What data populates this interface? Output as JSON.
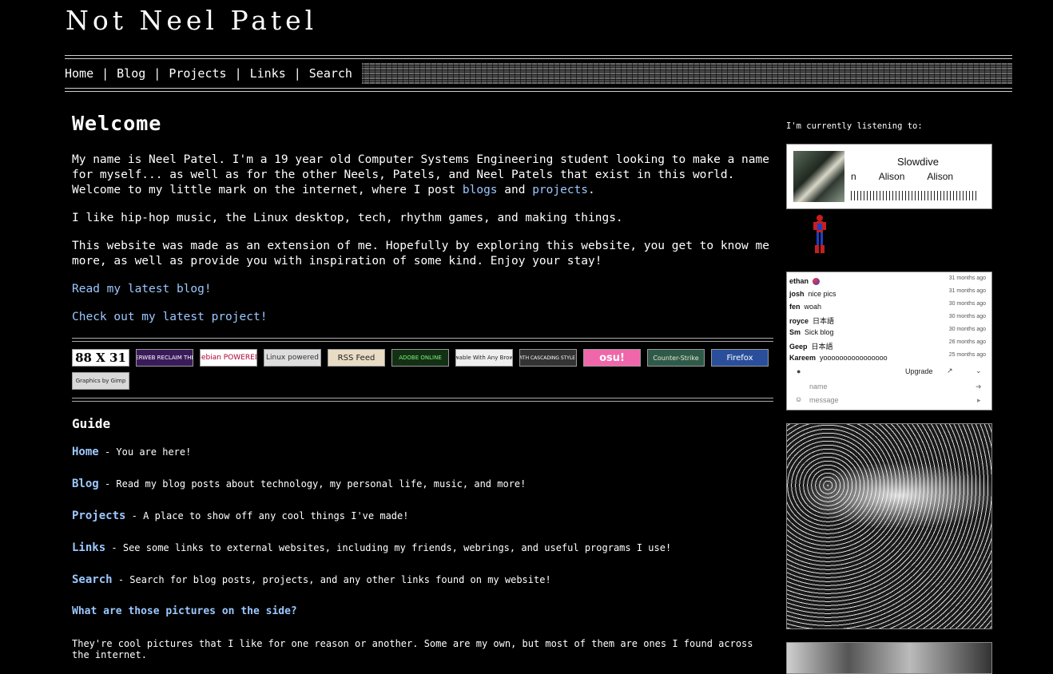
{
  "site": {
    "title": "Not Neel Patel"
  },
  "nav": {
    "items": [
      "Home",
      "Blog",
      "Projects",
      "Links",
      "Search"
    ],
    "separator": "|"
  },
  "welcome": {
    "heading": "Welcome",
    "p1_text": "My name is Neel Patel. I'm a 19 year old Computer Systems Engineering student looking to make a name for myself... as well as for the other Neels, Patels, and Neel Patels that exist in this world. Welcome to my little mark on the internet, where I post ",
    "p1_link1": "blogs",
    "p1_and": " and ",
    "p1_link2": "projects",
    "p1_end": ".",
    "p2": "I like hip-hop music, the Linux desktop, tech, rhythm games, and making things.",
    "p3": "This website was made as an extension of me. Hopefully by exploring this website, you get to know me more, as well as provide you with inspiration of some kind. Enjoy your stay!",
    "latest_blog": "Read my latest blog!",
    "latest_project": "Check out my latest project!"
  },
  "buttons": [
    "88 X 31",
    "YESTERWEB RECLAIM THE NET",
    "debian POWERED",
    "Linux powered",
    "RSS Feed",
    "ADOBE ONLINE",
    "Viewable With Any Browser",
    "MADE WITH CASCADING STYLE SHEETS",
    "osu!",
    "Counter-Strike",
    "Firefox",
    "Graphics by Gimp"
  ],
  "guide": {
    "heading": "Guide",
    "items": [
      {
        "label": "Home",
        "desc": "You are here!"
      },
      {
        "label": "Blog",
        "desc": "Read my blog posts about technology, my personal life, music, and more!"
      },
      {
        "label": "Projects",
        "desc": "A place to show off any cool things I've made!"
      },
      {
        "label": "Links",
        "desc": "See some links to external websites, including my friends, webrings, and useful programs I use!"
      },
      {
        "label": "Search",
        "desc": "Search for blog posts, projects, and any other links found on my website!"
      }
    ],
    "dash": "-",
    "question": "What are those pictures on the side?",
    "answer": "They're cool pictures that I like for one reason or another. Some are my own, but most of them are ones I found across the internet."
  },
  "sidebar": {
    "listening_label": "I'm currently listening to:",
    "now_playing": {
      "artist": "Slowdive",
      "row_n": "n",
      "album": "Alison",
      "track": "Alison"
    },
    "chat": {
      "messages": [
        {
          "user": "ethan",
          "text": "",
          "time": "31 months ago"
        },
        {
          "user": "josh",
          "text": "nice pics",
          "time": "31 months ago"
        },
        {
          "user": "fen",
          "text": "woah",
          "time": "30 months ago"
        },
        {
          "user": "royce",
          "text": "日本語",
          "time": "30 months ago"
        },
        {
          "user": "Sm",
          "text": "Sick blog",
          "time": "30 months ago"
        },
        {
          "user": "Geep",
          "text": "日本語",
          "time": "26 months ago"
        },
        {
          "user": "Kareem",
          "text": "yoooooooooooooooo",
          "time": "25 months ago"
        }
      ],
      "upgrade": "Upgrade",
      "name_placeholder": "name",
      "message_placeholder": "message"
    }
  }
}
